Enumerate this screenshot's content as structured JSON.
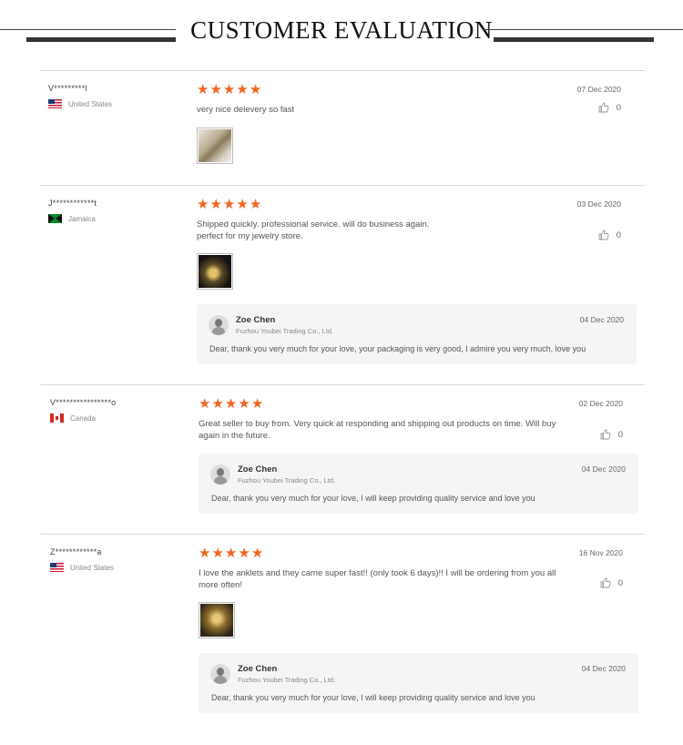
{
  "header": {
    "title": "CUSTOMER EVALUATION"
  },
  "colors": {
    "star": "#f16522",
    "divider": "#d8d8d8",
    "reply_bg": "#f4f5f7"
  },
  "reviews": [
    {
      "user": "V*********l",
      "country": "United States",
      "flag": "us-flag",
      "rating": 5,
      "date": "07 Dec 2020",
      "text": "very nice delevery so fast",
      "likes": "0",
      "has_photo": true
    },
    {
      "user": "J************t",
      "country": "Jamaica",
      "flag": "jamaica-flag",
      "rating": 5,
      "date": "03 Dec 2020",
      "text": "Shipped quickly. professional service. will do business again. perfect for my jewelry store.",
      "likes": "0",
      "has_photo": true,
      "reply": {
        "name": "Zoe Chen",
        "company": "Fuzhou Youbei Trading Co., Ltd.",
        "date": "04 Dec 2020",
        "text": "Dear, thank you very much for your love, your packaging is very good, I admire you very much, love you"
      }
    },
    {
      "user": "V****************o",
      "country": "Canada",
      "flag": "canada-flag",
      "rating": 5,
      "date": "02 Dec 2020",
      "text": "Great seller to buy from. Very quick at responding and shipping out products on time. Will buy again in the future.",
      "likes": "0",
      "has_photo": false,
      "reply": {
        "name": "Zoe Chen",
        "company": "Fuzhou Youbei Trading Co., Ltd.",
        "date": "04 Dec 2020",
        "text": "Dear, thank you very much for your love, I will keep providing quality service and love you"
      }
    },
    {
      "user": "Z************a",
      "country": "United States",
      "flag": "us-flag",
      "rating": 5,
      "date": "16 Nov 2020",
      "text": "I love the anklets and they came super fast!! (only took 6 days)!! I will be ordering from you all more often!",
      "likes": "0",
      "has_photo": true,
      "reply": {
        "name": "Zoe Chen",
        "company": "Fuzhou Youbei Trading Co., Ltd.",
        "date": "04 Dec 2020",
        "text": "Dear, thank you very much for your love, I will keep providing quality service and love you"
      }
    }
  ]
}
